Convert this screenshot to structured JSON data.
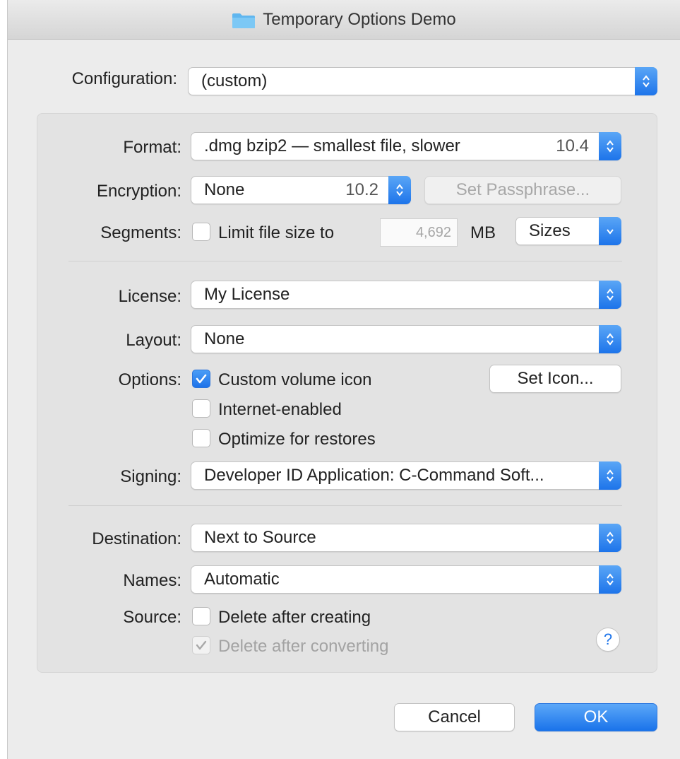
{
  "window": {
    "title": "Temporary Options Demo"
  },
  "configuration": {
    "label": "Configuration:",
    "value": "(custom)"
  },
  "format": {
    "label": "Format:",
    "value": ".dmg bzip2 — smallest file, slower",
    "version": "10.4"
  },
  "encryption": {
    "label": "Encryption:",
    "value": "None",
    "version": "10.2",
    "passphrase_button": "Set Passphrase..."
  },
  "segments": {
    "label": "Segments:",
    "checkbox_label": "Limit file size to",
    "size_value": "4,692",
    "unit": "MB",
    "sizes_button": "Sizes",
    "checked": false
  },
  "license": {
    "label": "License:",
    "value": "My License"
  },
  "layout": {
    "label": "Layout:",
    "value": "None"
  },
  "options": {
    "label": "Options:",
    "custom_icon": "Custom volume icon",
    "set_icon_button": "Set Icon...",
    "internet_enabled": "Internet-enabled",
    "optimize": "Optimize for restores"
  },
  "signing": {
    "label": "Signing:",
    "value": "Developer ID Application: C-Command Soft..."
  },
  "destination": {
    "label": "Destination:",
    "value": "Next to Source"
  },
  "names": {
    "label": "Names:",
    "value": "Automatic"
  },
  "source": {
    "label": "Source:",
    "delete_after_creating": "Delete after creating",
    "delete_after_converting": "Delete after converting"
  },
  "help": {
    "glyph": "?"
  },
  "buttons": {
    "cancel": "Cancel",
    "ok": "OK"
  },
  "colors": {
    "accent": "#1d74ea",
    "window_bg": "#ececec",
    "group_bg": "#e3e3e3"
  }
}
